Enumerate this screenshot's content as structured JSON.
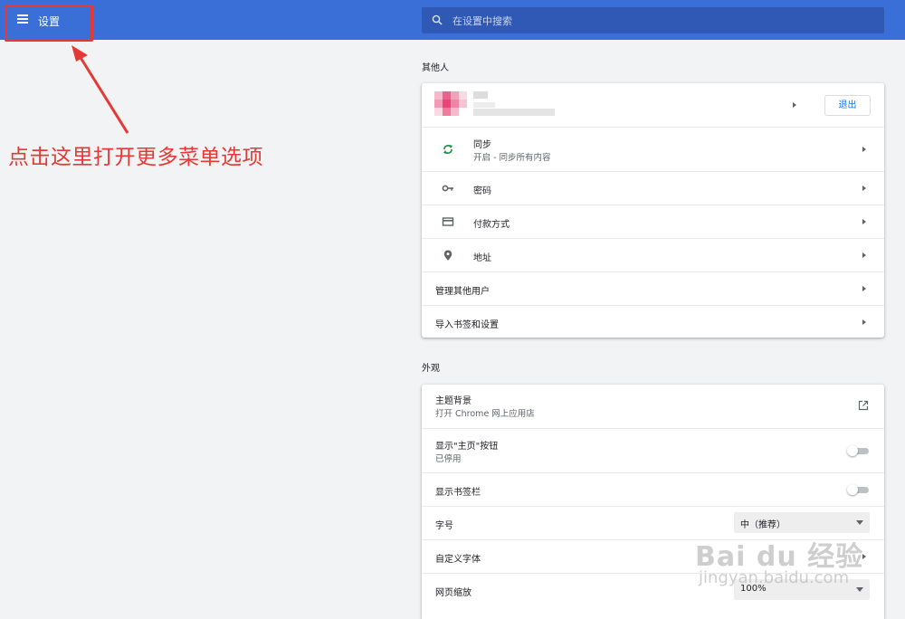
{
  "header": {
    "title": "设置",
    "search_placeholder": "在设置中搜索"
  },
  "annotation": {
    "text": "点击这里打开更多菜单选项",
    "color": "#e53935"
  },
  "people": {
    "section_title": "其他人",
    "signout_label": "退出",
    "items": [
      {
        "label": "同步",
        "sublabel": "开启 - 同步所有内容",
        "icon": "sync-icon"
      },
      {
        "label": "密码",
        "icon": "key-icon"
      },
      {
        "label": "付款方式",
        "icon": "credit-card-icon"
      },
      {
        "label": "地址",
        "icon": "location-pin-icon"
      }
    ],
    "manage_others_label": "管理其他用户",
    "import_label": "导入书签和设置"
  },
  "appearance": {
    "section_title": "外观",
    "theme_label": "主题背景",
    "theme_sublabel": "打开 Chrome 网上应用店",
    "home_button_label": "显示\"主页\"按钮",
    "home_button_sublabel": "已停用",
    "bookmarks_bar_label": "显示书签栏",
    "font_size_label": "字号",
    "font_size_value": "中（推荐）",
    "custom_fonts_label": "自定义字体",
    "page_zoom_label": "网页缩放",
    "page_zoom_value": "100%"
  },
  "watermark": {
    "line1": "Bai du 经验",
    "line2": "jingyan.baidu.com"
  },
  "colors": {
    "header_bg": "#3a6fd8",
    "search_bg": "#2f59b4",
    "accent": "#1a73e8",
    "annotation": "#e53935"
  }
}
